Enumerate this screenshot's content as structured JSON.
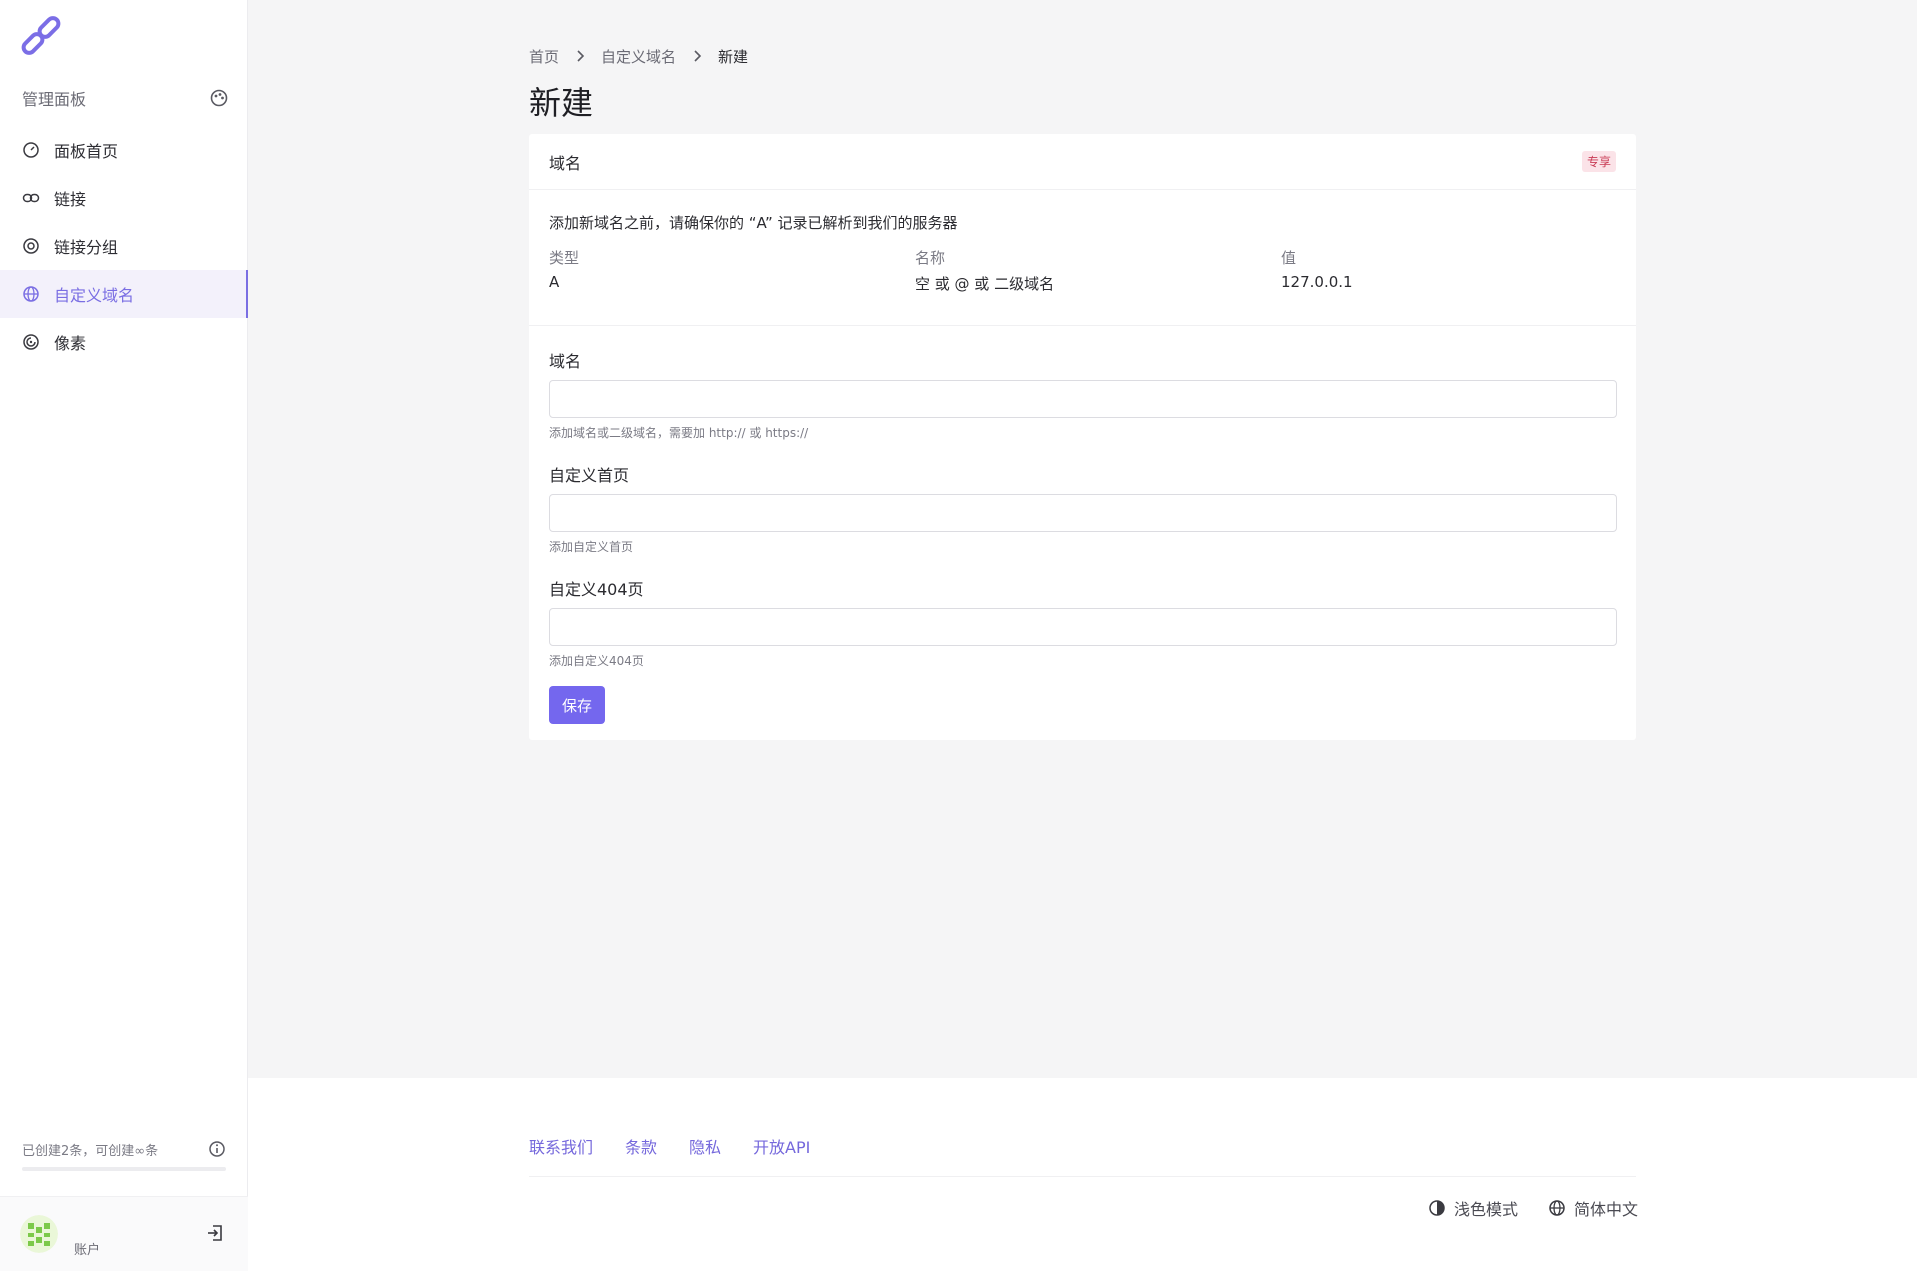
{
  "sidebar": {
    "header_label": "管理面板",
    "items": [
      {
        "label": "面板首页",
        "icon": "dashboard-icon"
      },
      {
        "label": "链接",
        "icon": "link-icon"
      },
      {
        "label": "链接分组",
        "icon": "target-icon"
      },
      {
        "label": "自定义域名",
        "icon": "globe-icon"
      },
      {
        "label": "像素",
        "icon": "pixel-icon"
      }
    ],
    "active_index": 3,
    "quota_text": "已创建2条，可创建∞条",
    "account_label": "账户"
  },
  "breadcrumb": {
    "items": [
      "首页",
      "自定义域名",
      "新建"
    ]
  },
  "page_title": "新建",
  "card": {
    "header_title": "域名",
    "badge": "专享",
    "note": "添加新域名之前，请确保你的 “A” 记录已解析到我们的服务器",
    "dns": {
      "headers": [
        "类型",
        "名称",
        "值"
      ],
      "row": [
        "A",
        "空 或 @ 或 二级域名",
        "127.0.0.1"
      ]
    }
  },
  "form": {
    "domain": {
      "label": "域名",
      "value": "",
      "hint": "添加域名或二级域名，需要加 http:// 或 https://"
    },
    "homepage": {
      "label": "自定义首页",
      "value": "",
      "hint": "添加自定义首页"
    },
    "page404": {
      "label": "自定义404页",
      "value": "",
      "hint": "添加自定义404页"
    },
    "save_label": "保存"
  },
  "footer": {
    "links": [
      "联系我们",
      "条款",
      "隐私",
      "开放API"
    ],
    "theme_label": "浅色模式",
    "language_label": "简体中文"
  },
  "colors": {
    "accent": "#7467ee",
    "badge_text": "#c93b55",
    "badge_bg": "#fbe3e8"
  }
}
